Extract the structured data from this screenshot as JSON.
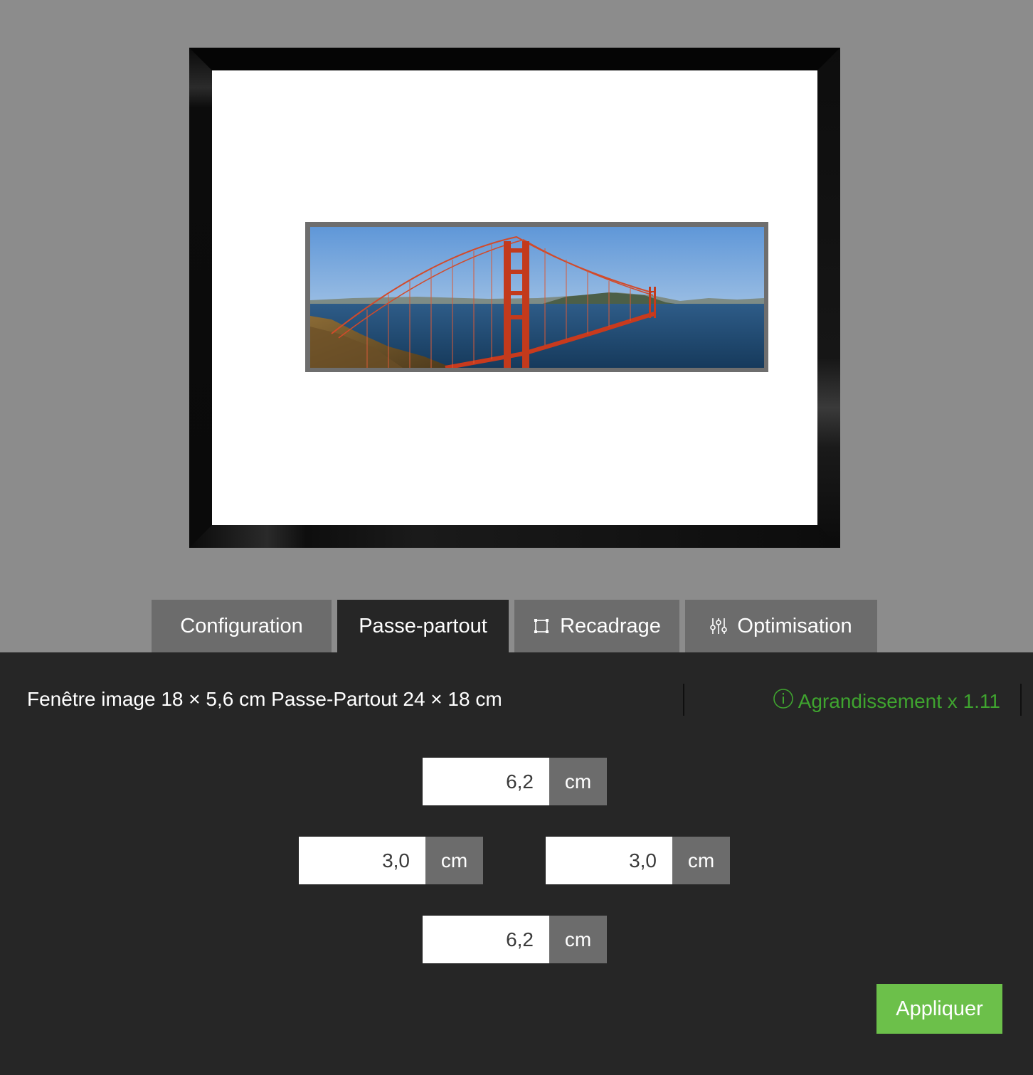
{
  "tabs": [
    {
      "label": "Configuration",
      "icon": "",
      "active": false
    },
    {
      "label": "Passe-partout",
      "icon": "",
      "active": true
    },
    {
      "label": "Recadrage",
      "icon": "crop-icon",
      "active": false
    },
    {
      "label": "Optimisation",
      "icon": "sliders-icon",
      "active": false
    }
  ],
  "info": {
    "dimensions_text": "Fenêtre image 18 × 5,6 cm Passe-Partout 24 × 18 cm",
    "enlargement_text": "Agrandissement x 1.11",
    "enlargement_icon": "info-circle-icon",
    "enlargement_color": "#3fa42f"
  },
  "margins": {
    "top": {
      "value": "6,2",
      "unit": "cm"
    },
    "left": {
      "value": "3,0",
      "unit": "cm"
    },
    "right": {
      "value": "3,0",
      "unit": "cm"
    },
    "bottom": {
      "value": "6,2",
      "unit": "cm"
    }
  },
  "apply_label": "Appliquer",
  "colors": {
    "apply_button": "#6cc04a",
    "panel_background": "#262626",
    "tab_inactive": "#6c6c6c",
    "preview_background": "#8c8c8c"
  }
}
